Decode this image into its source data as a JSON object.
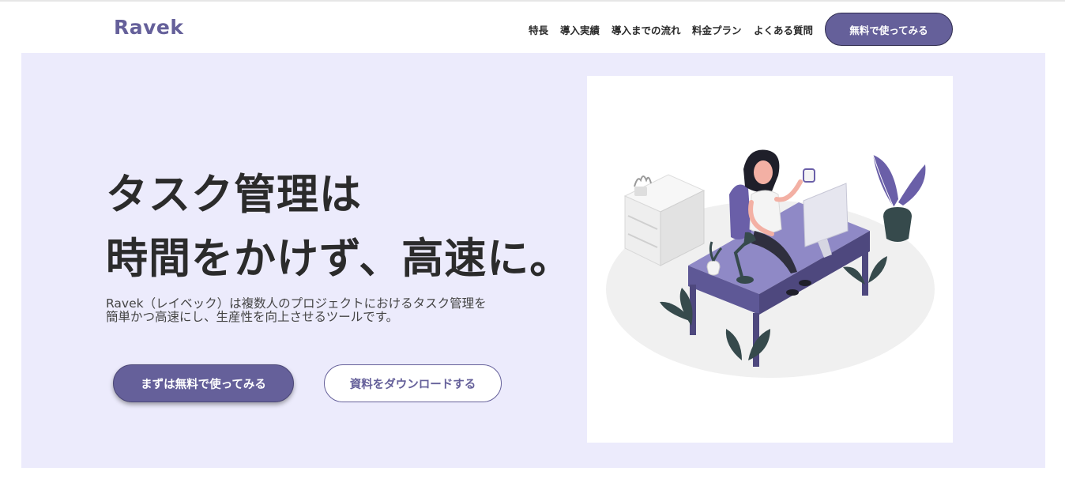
{
  "header": {
    "logo": "Ravek",
    "nav": [
      "特長",
      "導入実績",
      "導入までの流れ",
      "料金プラン",
      "よくある質問"
    ],
    "cta": "無料で使ってみる"
  },
  "hero": {
    "title_line1": "タスク管理は",
    "title_line2": "時間をかけず、高速に。",
    "description_line1": "Ravek（レイベック）は複数人のプロジェクトにおけるタスク管理を",
    "description_line2": "簡単かつ高速にし、生産性を向上させるツールです。",
    "primary_button": "まずは無料で使ってみる",
    "secondary_button": "資料をダウンロードする"
  },
  "colors": {
    "brand": "#65609a",
    "hero_background": "#ecebfc",
    "text": "#2b2b2b"
  },
  "icons": {
    "illustration": "woman-at-desk-illustration"
  }
}
